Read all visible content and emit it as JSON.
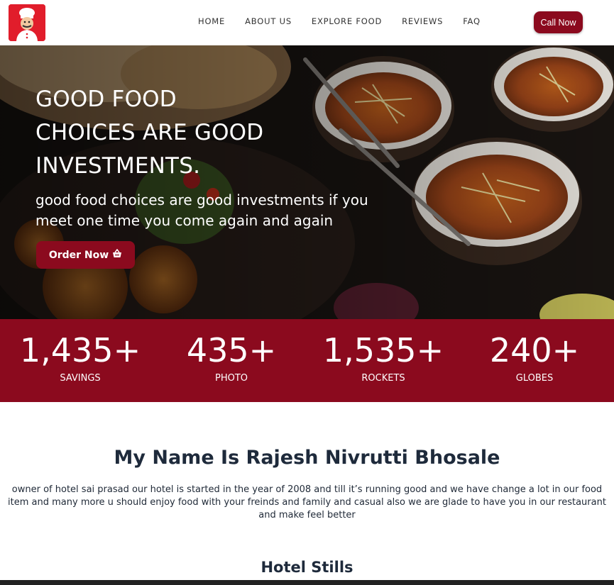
{
  "nav": {
    "logo_alt": "Hotel Sai Prasad chef logo",
    "links": [
      "HOME",
      "ABOUT US",
      "EXPLORE FOOD",
      "REVIEWS",
      "FAQ"
    ],
    "call_label": "Call Now"
  },
  "hero": {
    "title": "GOOD FOOD\nCHOICES ARE GOOD\nINVESTMENTS.",
    "subtitle": "good food choices are good investments if you meet one time you come again and again",
    "order_label": "Order Now"
  },
  "stats": [
    {
      "value": "1,435+",
      "label": "SAVINGS"
    },
    {
      "value": "435+",
      "label": "PHOTO"
    },
    {
      "value": "1,535+",
      "label": "ROCKETS"
    },
    {
      "value": "240+",
      "label": "GLOBES"
    }
  ],
  "about": {
    "title": "My Name Is Rajesh Nivrutti Bhosale",
    "text": "owner of hotel sai prasad our hotel is started in the year of 2008 and till it’s running good and we have change a lot in our food item and many more u should enjoy food with your freinds and family and casual also we are glade to have you in our restaurant and make feel better"
  },
  "stills": {
    "title": "Hotel Stills"
  },
  "colors": {
    "brand": "#8b0a1e",
    "logo_bg": "#e11d2b",
    "heading": "#1e2a3b"
  },
  "icons": {
    "basket": "shopping-basket-icon",
    "logo": "chef-logo-icon"
  }
}
